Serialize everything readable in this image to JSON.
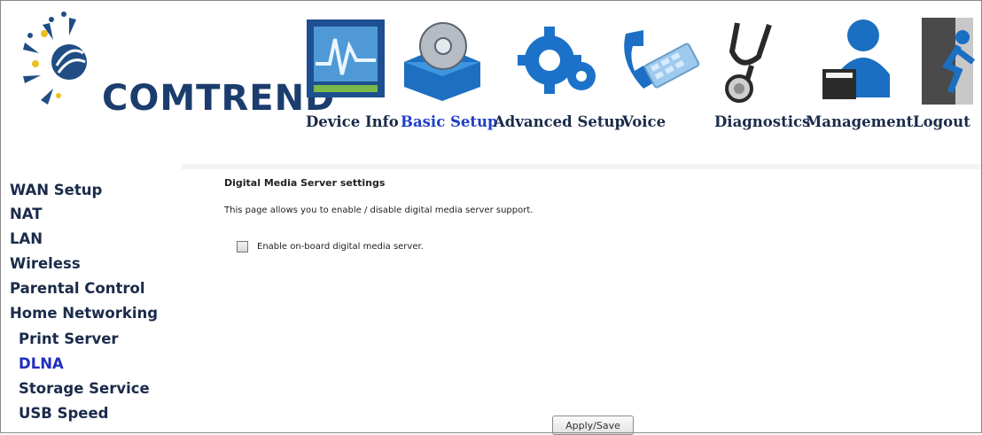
{
  "brand": {
    "name": "COMTREND",
    "color": "#1b3d6e"
  },
  "nav": {
    "items": [
      {
        "id": "device-info",
        "label": "Device Info",
        "icon": "chart-monitor-icon"
      },
      {
        "id": "basic-setup",
        "label": "Basic Setup",
        "icon": "disc-box-icon",
        "active": true
      },
      {
        "id": "advanced-setup",
        "label": "Advanced Setup",
        "icon": "gears-icon"
      },
      {
        "id": "voice",
        "label": "Voice",
        "icon": "phone-handset-icon"
      },
      {
        "id": "diagnostics",
        "label": "Diagnostics",
        "icon": "stethoscope-icon"
      },
      {
        "id": "management",
        "label": "Management",
        "icon": "user-card-icon"
      },
      {
        "id": "logout",
        "label": "Logout",
        "icon": "exit-door-icon"
      }
    ],
    "active_color": "#1f3fc8"
  },
  "sidebar": {
    "items": [
      {
        "label": "WAN Setup"
      },
      {
        "label": "NAT"
      },
      {
        "label": "LAN"
      },
      {
        "label": "Wireless"
      },
      {
        "label": "Parental Control"
      },
      {
        "label": "Home Networking"
      },
      {
        "label": "Print Server",
        "sub": true
      },
      {
        "label": "DLNA",
        "sub": true,
        "active": true
      },
      {
        "label": "Storage Service",
        "sub": true
      },
      {
        "label": "USB Speed",
        "sub": true
      }
    ]
  },
  "main": {
    "caption": "Digital Media Server settings",
    "description": "This page allows you to enable / disable digital media server support.",
    "enable_label": "Enable on-board digital media server.",
    "enable_checked": false,
    "apply_label": "Apply/Save"
  }
}
